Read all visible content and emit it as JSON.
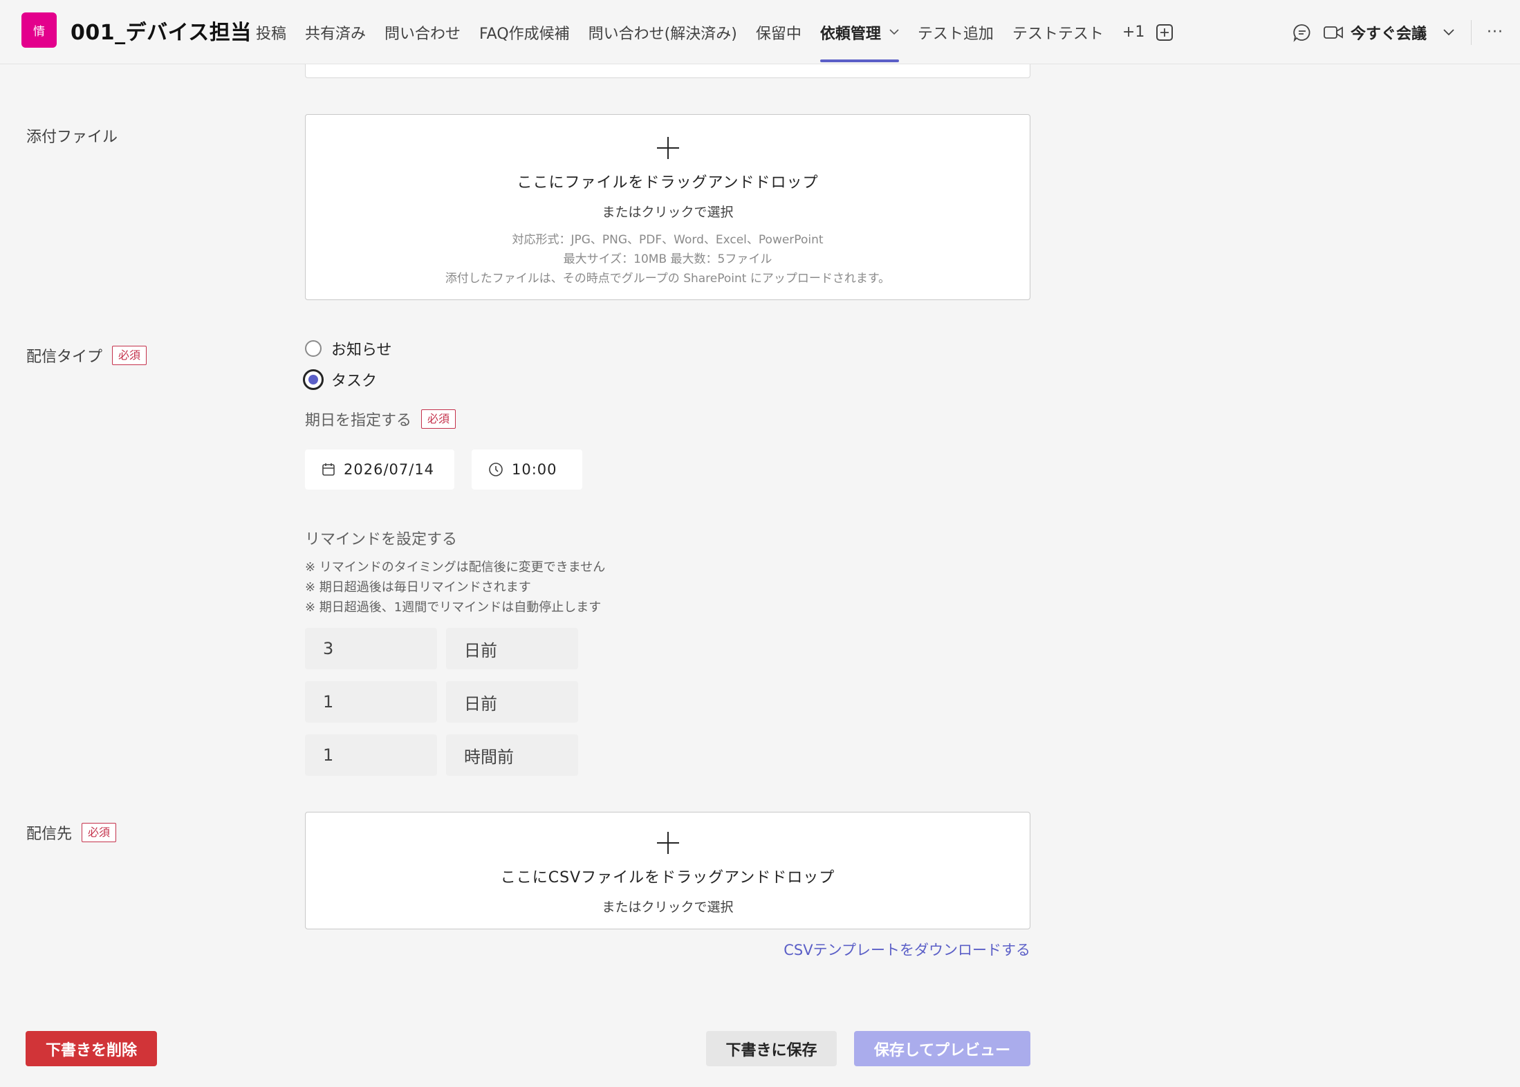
{
  "header": {
    "team_avatar": "情",
    "team_name": "001_デバイス担当",
    "tabs": [
      {
        "label": "投稿"
      },
      {
        "label": "共有済み"
      },
      {
        "label": "問い合わせ"
      },
      {
        "label": "FAQ作成候補"
      },
      {
        "label": "問い合わせ(解決済み)"
      },
      {
        "label": "保留中"
      },
      {
        "label": "依頼管理",
        "active": true
      },
      {
        "label": "テスト追加"
      },
      {
        "label": "テストテスト"
      }
    ],
    "overflow_count": "+1",
    "meet_now_label": "今すぐ会議",
    "more_label": "···"
  },
  "attachment": {
    "label": "添付ファイル",
    "drop_text": "ここにファイルをドラッグアンドドロップ",
    "click_text": "またはクリックで選択",
    "formats": "対応形式：JPG、PNG、PDF、Word、Excel、PowerPoint",
    "limits": "最大サイズ：10MB 最大数：5ファイル",
    "sharepoint_note": "添付したファイルは、その時点でグループの SharePoint にアップロードされます。"
  },
  "delivery_type": {
    "label": "配信タイプ",
    "required": "必須",
    "options": [
      {
        "label": "お知らせ",
        "checked": false
      },
      {
        "label": "タスク",
        "checked": true
      }
    ]
  },
  "due_date": {
    "label": "期日を指定する",
    "required": "必須",
    "date": "2026/07/14",
    "time": "10:00"
  },
  "reminder": {
    "label": "リマインドを設定する",
    "notes": [
      "※ リマインドのタイミングは配信後に変更できません",
      "※ 期日超過後は毎日リマインドされます",
      "※ 期日超過後、1週間でリマインドは自動停止します"
    ],
    "rows": [
      {
        "value": "3",
        "unit": "日前"
      },
      {
        "value": "1",
        "unit": "日前"
      },
      {
        "value": "1",
        "unit": "時間前"
      }
    ]
  },
  "recipients": {
    "label": "配信先",
    "required": "必須",
    "drop_text": "ここにCSVファイルをドラッグアンドドロップ",
    "click_text": "またはクリックで選択",
    "template_link": "CSVテンプレートをダウンロードする"
  },
  "actions": {
    "delete_draft": "下書きを削除",
    "save_draft": "下書きに保存",
    "save_preview": "保存してプレビュー"
  },
  "colors": {
    "accent": "#5b5fc7",
    "team_avatar_bg": "#e3008c",
    "danger": "#d13438",
    "required": "#c4314b",
    "preview_disabled": "#aaacec"
  }
}
